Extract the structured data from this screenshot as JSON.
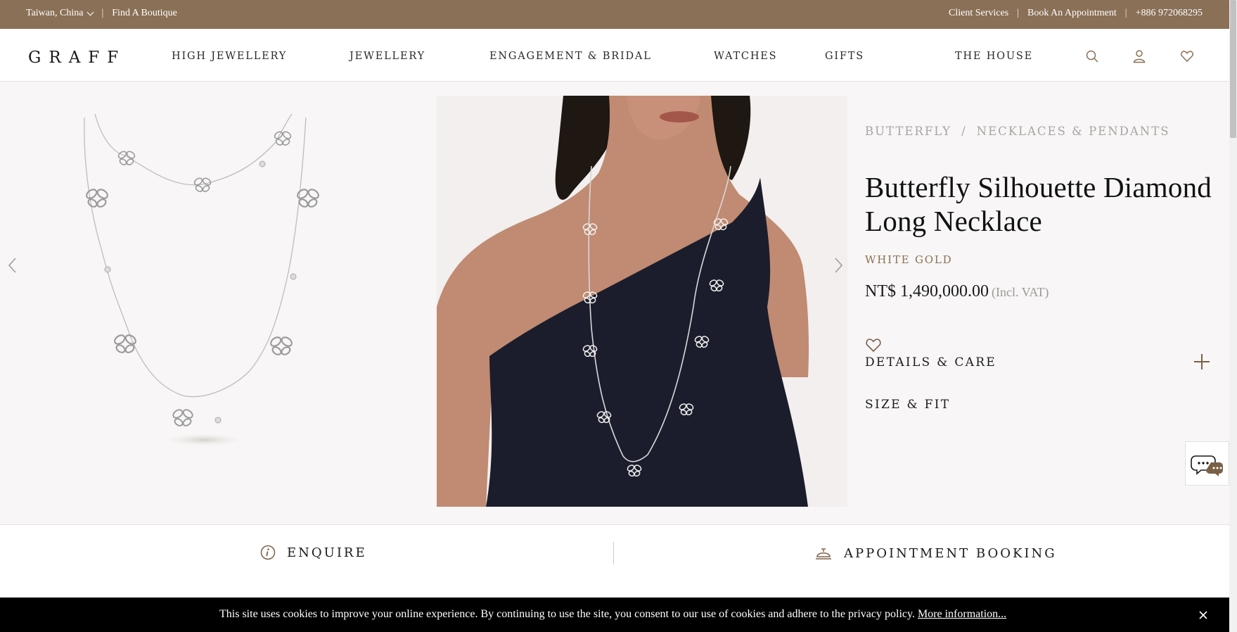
{
  "utility": {
    "region": "Taiwan, China",
    "find_boutique": "Find A Boutique",
    "client_services": "Client Services",
    "book_appointment": "Book An Appointment",
    "phone": "+886 972068295",
    "separator": "|"
  },
  "brand": {
    "logo": "GRAFF"
  },
  "nav": {
    "items": [
      {
        "label": "HIGH JEWELLERY"
      },
      {
        "label": "JEWELLERY"
      },
      {
        "label": "ENGAGEMENT & BRIDAL"
      },
      {
        "label": "WATCHES"
      },
      {
        "label": "GIFTS"
      },
      {
        "label": "THE HOUSE"
      }
    ],
    "icons": [
      "search-icon",
      "account-icon",
      "wishlist-icon"
    ]
  },
  "product": {
    "breadcrumb": [
      "BUTTERFLY",
      "NECKLACES & PENDANTS"
    ],
    "breadcrumb_sep": "/",
    "title": "Butterfly Silhouette Diamond Long Necklace",
    "metal": "WHITE GOLD",
    "price": "NT$ 1,490,000.00",
    "vat_note": "(Incl. VAT)",
    "accordions": [
      {
        "label": "DETAILS & CARE"
      },
      {
        "label": "SIZE & FIT"
      }
    ],
    "images": [
      "necklace-product-image",
      "model-wearing-necklace-image"
    ]
  },
  "actions": {
    "enquire": "ENQUIRE",
    "appointment": "APPOINTMENT BOOKING"
  },
  "cookie": {
    "text": "This site uses cookies to improve your online experience. By continuing to use the site, you consent to our use of cookies and adhere to the privacy policy.",
    "link": "More information..."
  },
  "colors": {
    "brand_brown": "#8a7056",
    "background": "#f8f6f6",
    "cookie_bg": "#000000",
    "muted_text": "#a9a5a2"
  }
}
